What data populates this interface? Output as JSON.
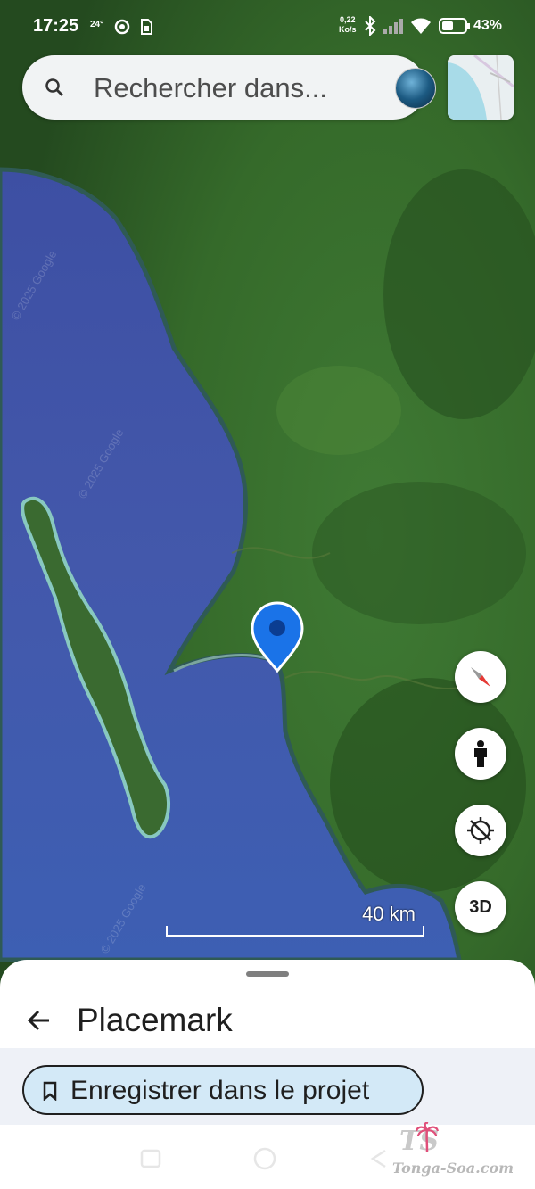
{
  "status_bar": {
    "time": "17:25",
    "indicator": "24°",
    "net_speed_value": "0,22",
    "net_speed_unit": "Ko/s",
    "battery": "43%"
  },
  "search": {
    "placeholder": "Rechercher dans..."
  },
  "map": {
    "scale_label": "40 km",
    "watermark_1": "© 2025 Google",
    "watermark_2": "© 2025 Google",
    "watermark_3": "© 2025 Google"
  },
  "controls": {
    "three_d_label": "3D"
  },
  "sheet": {
    "title": "Placemark",
    "save_label": "Enregistrer dans le projet"
  },
  "watermark": {
    "brand_initials": "TS",
    "brand": "Tonga-Soa.com"
  },
  "icons": [
    "search-icon",
    "avatar",
    "layers-icon",
    "compass-icon",
    "street-view-icon",
    "location-icon",
    "back-arrow-icon",
    "bookmark-icon",
    "placemark-pin-icon"
  ],
  "colors": {
    "pin": "#1a73e8",
    "chip_bg": "#d3e9f7",
    "ocean": "#3a4fa6",
    "land": "#3f6d2c"
  }
}
